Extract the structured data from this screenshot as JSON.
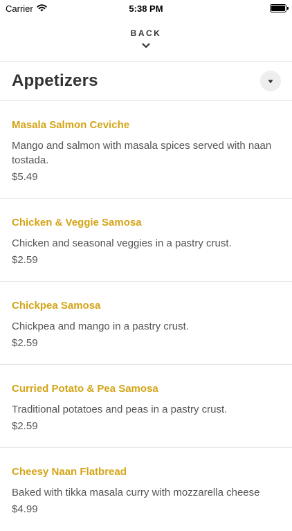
{
  "status_bar": {
    "carrier": "Carrier",
    "time": "5:38 PM",
    "icons": [
      "wifi-icon",
      "battery-icon"
    ]
  },
  "nav": {
    "back_label": "BACK",
    "icon": "chevron-down-icon"
  },
  "section": {
    "title": "Appetizers",
    "toggle_icon": "triangle-down-icon"
  },
  "colors": {
    "item_name": "#d4a417",
    "text": "#555555",
    "divider": "#e6e6e6"
  },
  "menu_items": [
    {
      "name": "Masala Salmon Ceviche",
      "description": "Mango and salmon with masala spices served with naan tostada.",
      "price": "$5.49"
    },
    {
      "name": "Chicken & Veggie Samosa",
      "description": "Chicken and seasonal veggies in a pastry crust.",
      "price": "$2.59"
    },
    {
      "name": "Chickpea Samosa",
      "description": "Chickpea and mango in a pastry crust.",
      "price": "$2.59"
    },
    {
      "name": "Curried Potato & Pea Samosa",
      "description": "Traditional potatoes and peas in a pastry crust.",
      "price": "$2.59"
    },
    {
      "name": "Cheesy Naan Flatbread",
      "description": "Baked with tikka masala curry with mozzarella cheese",
      "price": "$4.99"
    }
  ]
}
